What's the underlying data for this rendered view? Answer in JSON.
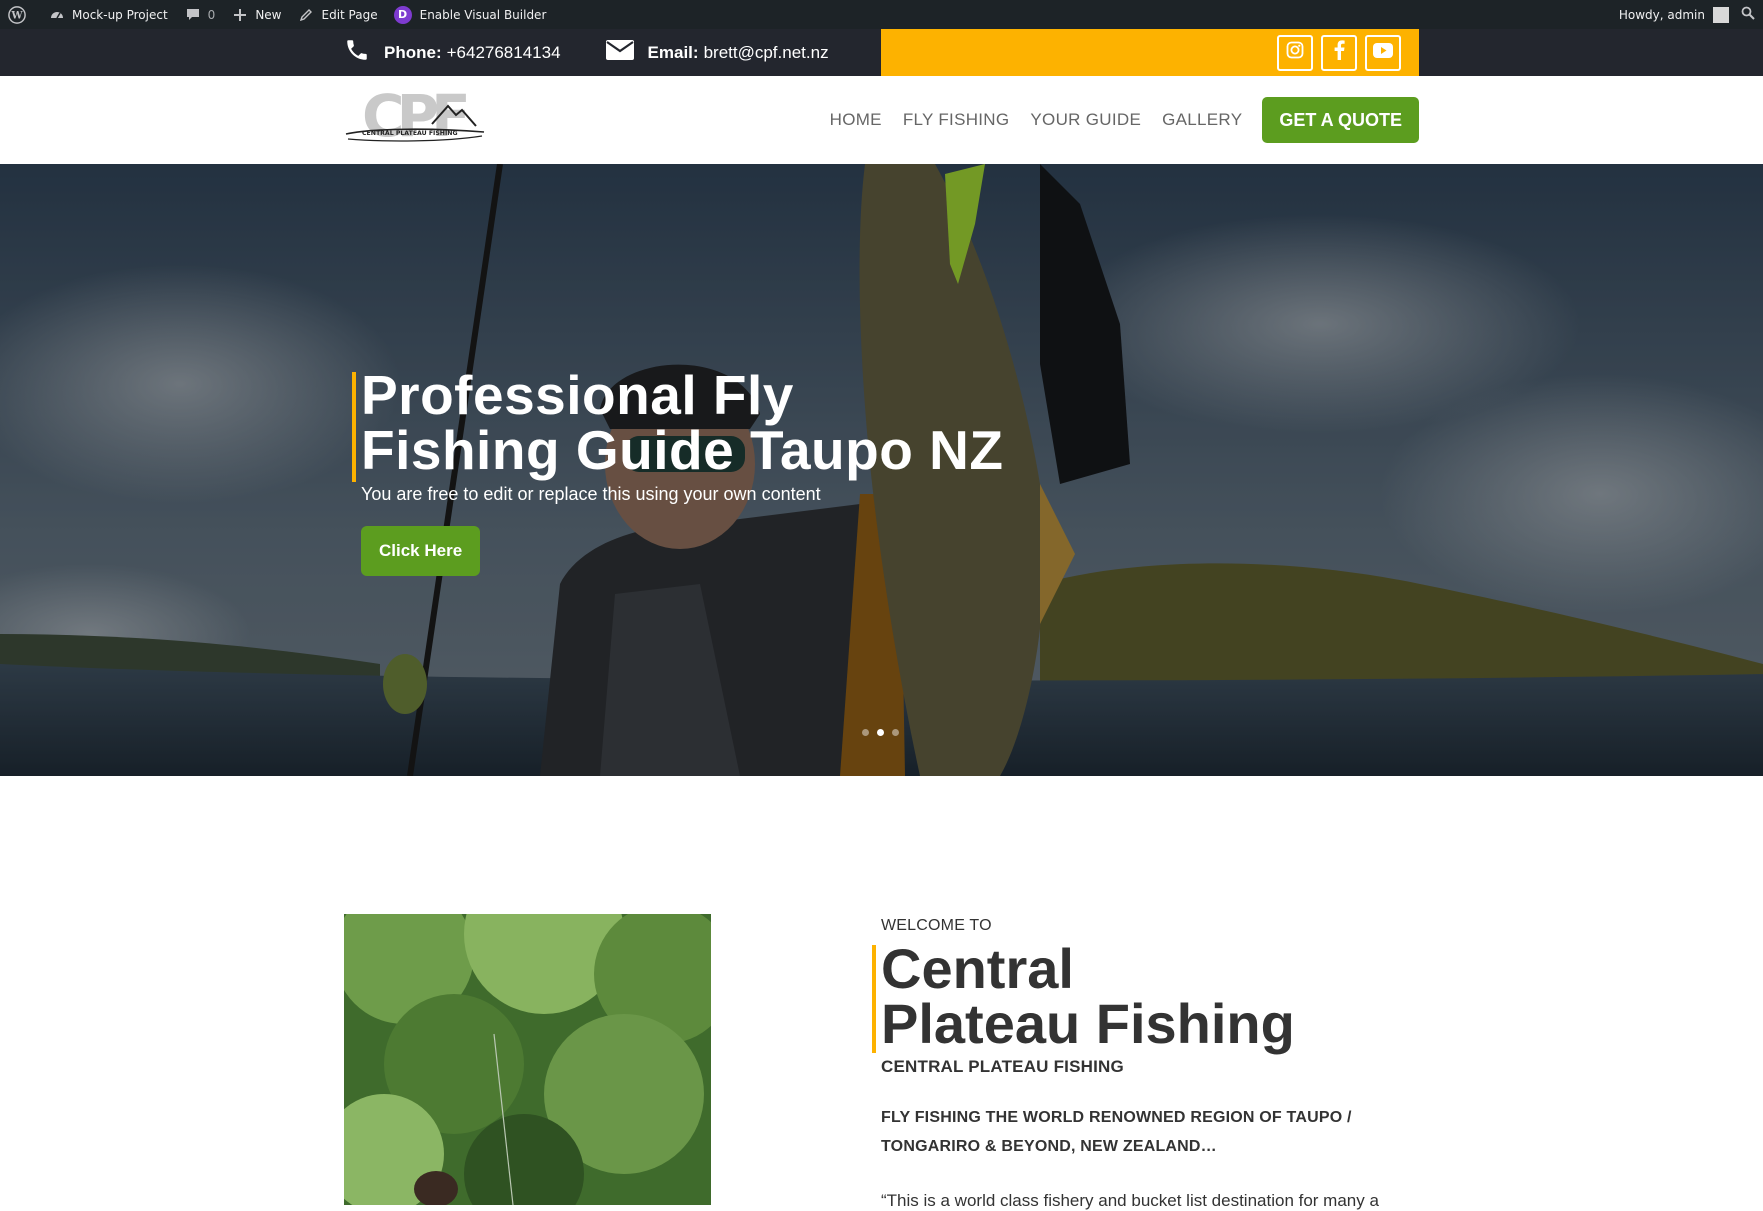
{
  "adminbar": {
    "site_name": "Mock-up Project",
    "comments_count": "0",
    "new_label": "New",
    "edit_label": "Edit Page",
    "builder_label": "Enable Visual Builder",
    "builder_badge": "D",
    "howdy": "Howdy, admin"
  },
  "contact": {
    "phone_label": "Phone:",
    "phone_value": "+64276814134",
    "email_label": "Email:",
    "email_value": "brett@cpf.net.nz"
  },
  "social": [
    "instagram-icon",
    "facebook-icon",
    "youtube-icon"
  ],
  "logo": {
    "letters": "CPF",
    "caption": "CENTRAL PLATEAU FISHING"
  },
  "nav": {
    "items": [
      "HOME",
      "FLY FISHING",
      "YOUR GUIDE",
      "GALLERY"
    ],
    "cta": "GET A QUOTE"
  },
  "hero": {
    "title_line1": "Professional Fly",
    "title_line2": "Fishing Guide Taupo NZ",
    "subtitle": "You are free to edit or replace this using your own content",
    "button": "Click Here",
    "slides_count": 3,
    "active_slide": 2
  },
  "welcome": {
    "eyebrow": "WELCOME TO",
    "title_line1": "Central",
    "title_line2": "Plateau Fishing",
    "subtitle": "CENTRAL PLATEAU FISHING",
    "lead_line1": "FLY FISHING THE WORLD RENOWNED REGION OF TAUPO /",
    "lead_line2": "TONGARIRO & BEYOND, NEW ZEALAND…",
    "quote_start": "“This is a world class fishery and bucket list destination for many a"
  },
  "colors": {
    "accent_yellow": "#fdb200",
    "cta_green": "#5c9d1f",
    "topbar_dark": "#23262e",
    "adminbar": "#1d2327"
  }
}
